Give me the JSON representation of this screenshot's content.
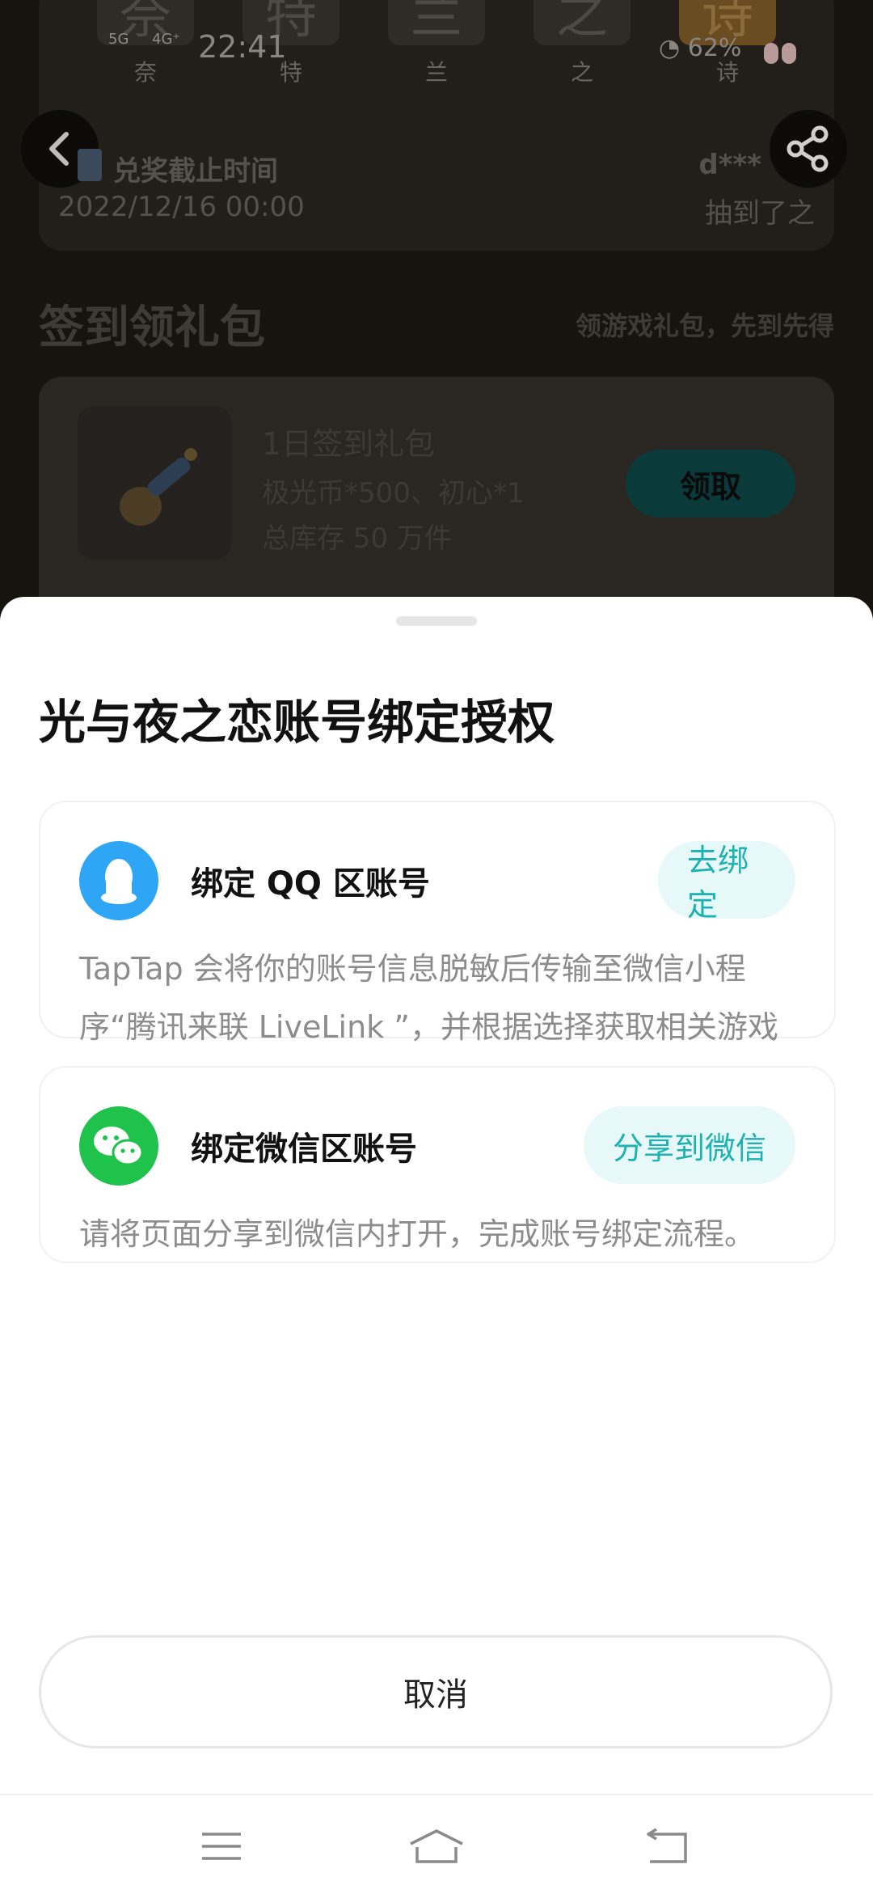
{
  "status_bar": {
    "network_5g": "5G",
    "network_4g": "4G⁺",
    "time": "22:41",
    "battery": "62%"
  },
  "letters": [
    {
      "char": "奈",
      "label": "奈",
      "gold": false
    },
    {
      "char": "特",
      "label": "特",
      "gold": false
    },
    {
      "char": "兰",
      "label": "兰",
      "gold": false
    },
    {
      "char": "之",
      "label": "之",
      "gold": false
    },
    {
      "char": "诗",
      "label": "诗",
      "gold": true
    }
  ],
  "redeem": {
    "label": "兑奖截止时间",
    "date": "2022/12/16 00:00",
    "winner_name": "d***",
    "winner_desc": "抽到了之"
  },
  "signin": {
    "title": "签到领礼包",
    "subtitle": "领游戏礼包，先到先得"
  },
  "gift": {
    "title": "1日签到礼包",
    "desc": "极光币*500、初心*1",
    "stock": "总库存 50 万件",
    "button": "领取"
  },
  "sheet": {
    "title": "光与夜之恋账号绑定授权",
    "qq": {
      "title": "绑定 QQ 区账号",
      "button": "去绑定",
      "description": "TapTap 会将你的账号信息脱敏后传输至微信小程序“腾讯来联 LiveLink ”，并根据选择获取相关游戏信息，完成账号绑定授权。",
      "icon": "qq-penguin-icon",
      "color": "#2fa6f5"
    },
    "wechat": {
      "title": "绑定微信区账号",
      "button": "分享到微信",
      "description": "请将页面分享到微信内打开，完成账号绑定流程。",
      "icon": "wechat-icon",
      "color": "#1fc34b"
    },
    "cancel": "取消"
  },
  "colors": {
    "accent": "#1fb0b0",
    "accent_bg": "#e6f8f8"
  }
}
